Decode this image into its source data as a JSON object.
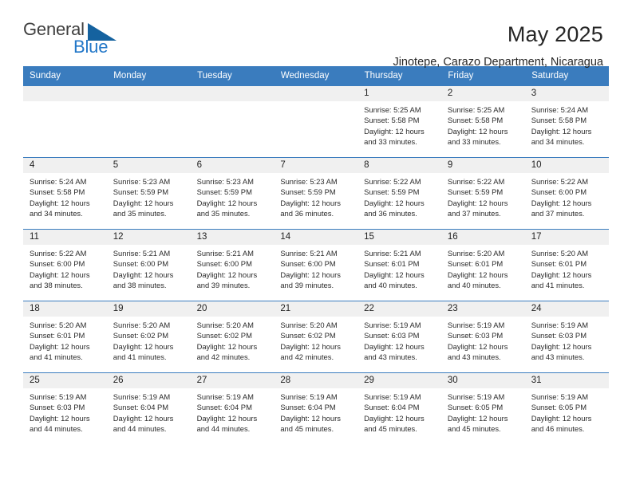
{
  "brand": {
    "name_primary": "General",
    "name_secondary": "Blue",
    "triangle_color": "#15629f",
    "blue_color": "#2277c8"
  },
  "header": {
    "title": "May 2025",
    "subtitle": "Jinotepe, Carazo Department, Nicaragua"
  },
  "theme": {
    "header_blue": "#3a7cbe",
    "daynum_band": "#f0f0f0",
    "text": "#2b2b2b"
  },
  "weekday_headers": [
    "Sunday",
    "Monday",
    "Tuesday",
    "Wednesday",
    "Thursday",
    "Friday",
    "Saturday"
  ],
  "labels": {
    "sunrise_prefix": "Sunrise: ",
    "sunset_prefix": "Sunset: ",
    "daylight_prefix": "Daylight: "
  },
  "weeks": [
    [
      {
        "day": "",
        "empty": true,
        "sunrise": "",
        "sunset": "",
        "daylight_line1": "",
        "daylight_line2": ""
      },
      {
        "day": "",
        "empty": true,
        "sunrise": "",
        "sunset": "",
        "daylight_line1": "",
        "daylight_line2": ""
      },
      {
        "day": "",
        "empty": true,
        "sunrise": "",
        "sunset": "",
        "daylight_line1": "",
        "daylight_line2": ""
      },
      {
        "day": "",
        "empty": true,
        "sunrise": "",
        "sunset": "",
        "daylight_line1": "",
        "daylight_line2": ""
      },
      {
        "day": "1",
        "empty": false,
        "sunrise": "Sunrise: 5:25 AM",
        "sunset": "Sunset: 5:58 PM",
        "daylight_line1": "Daylight: 12 hours",
        "daylight_line2": "and 33 minutes."
      },
      {
        "day": "2",
        "empty": false,
        "sunrise": "Sunrise: 5:25 AM",
        "sunset": "Sunset: 5:58 PM",
        "daylight_line1": "Daylight: 12 hours",
        "daylight_line2": "and 33 minutes."
      },
      {
        "day": "3",
        "empty": false,
        "sunrise": "Sunrise: 5:24 AM",
        "sunset": "Sunset: 5:58 PM",
        "daylight_line1": "Daylight: 12 hours",
        "daylight_line2": "and 34 minutes."
      }
    ],
    [
      {
        "day": "4",
        "empty": false,
        "sunrise": "Sunrise: 5:24 AM",
        "sunset": "Sunset: 5:58 PM",
        "daylight_line1": "Daylight: 12 hours",
        "daylight_line2": "and 34 minutes."
      },
      {
        "day": "5",
        "empty": false,
        "sunrise": "Sunrise: 5:23 AM",
        "sunset": "Sunset: 5:59 PM",
        "daylight_line1": "Daylight: 12 hours",
        "daylight_line2": "and 35 minutes."
      },
      {
        "day": "6",
        "empty": false,
        "sunrise": "Sunrise: 5:23 AM",
        "sunset": "Sunset: 5:59 PM",
        "daylight_line1": "Daylight: 12 hours",
        "daylight_line2": "and 35 minutes."
      },
      {
        "day": "7",
        "empty": false,
        "sunrise": "Sunrise: 5:23 AM",
        "sunset": "Sunset: 5:59 PM",
        "daylight_line1": "Daylight: 12 hours",
        "daylight_line2": "and 36 minutes."
      },
      {
        "day": "8",
        "empty": false,
        "sunrise": "Sunrise: 5:22 AM",
        "sunset": "Sunset: 5:59 PM",
        "daylight_line1": "Daylight: 12 hours",
        "daylight_line2": "and 36 minutes."
      },
      {
        "day": "9",
        "empty": false,
        "sunrise": "Sunrise: 5:22 AM",
        "sunset": "Sunset: 5:59 PM",
        "daylight_line1": "Daylight: 12 hours",
        "daylight_line2": "and 37 minutes."
      },
      {
        "day": "10",
        "empty": false,
        "sunrise": "Sunrise: 5:22 AM",
        "sunset": "Sunset: 6:00 PM",
        "daylight_line1": "Daylight: 12 hours",
        "daylight_line2": "and 37 minutes."
      }
    ],
    [
      {
        "day": "11",
        "empty": false,
        "sunrise": "Sunrise: 5:22 AM",
        "sunset": "Sunset: 6:00 PM",
        "daylight_line1": "Daylight: 12 hours",
        "daylight_line2": "and 38 minutes."
      },
      {
        "day": "12",
        "empty": false,
        "sunrise": "Sunrise: 5:21 AM",
        "sunset": "Sunset: 6:00 PM",
        "daylight_line1": "Daylight: 12 hours",
        "daylight_line2": "and 38 minutes."
      },
      {
        "day": "13",
        "empty": false,
        "sunrise": "Sunrise: 5:21 AM",
        "sunset": "Sunset: 6:00 PM",
        "daylight_line1": "Daylight: 12 hours",
        "daylight_line2": "and 39 minutes."
      },
      {
        "day": "14",
        "empty": false,
        "sunrise": "Sunrise: 5:21 AM",
        "sunset": "Sunset: 6:00 PM",
        "daylight_line1": "Daylight: 12 hours",
        "daylight_line2": "and 39 minutes."
      },
      {
        "day": "15",
        "empty": false,
        "sunrise": "Sunrise: 5:21 AM",
        "sunset": "Sunset: 6:01 PM",
        "daylight_line1": "Daylight: 12 hours",
        "daylight_line2": "and 40 minutes."
      },
      {
        "day": "16",
        "empty": false,
        "sunrise": "Sunrise: 5:20 AM",
        "sunset": "Sunset: 6:01 PM",
        "daylight_line1": "Daylight: 12 hours",
        "daylight_line2": "and 40 minutes."
      },
      {
        "day": "17",
        "empty": false,
        "sunrise": "Sunrise: 5:20 AM",
        "sunset": "Sunset: 6:01 PM",
        "daylight_line1": "Daylight: 12 hours",
        "daylight_line2": "and 41 minutes."
      }
    ],
    [
      {
        "day": "18",
        "empty": false,
        "sunrise": "Sunrise: 5:20 AM",
        "sunset": "Sunset: 6:01 PM",
        "daylight_line1": "Daylight: 12 hours",
        "daylight_line2": "and 41 minutes."
      },
      {
        "day": "19",
        "empty": false,
        "sunrise": "Sunrise: 5:20 AM",
        "sunset": "Sunset: 6:02 PM",
        "daylight_line1": "Daylight: 12 hours",
        "daylight_line2": "and 41 minutes."
      },
      {
        "day": "20",
        "empty": false,
        "sunrise": "Sunrise: 5:20 AM",
        "sunset": "Sunset: 6:02 PM",
        "daylight_line1": "Daylight: 12 hours",
        "daylight_line2": "and 42 minutes."
      },
      {
        "day": "21",
        "empty": false,
        "sunrise": "Sunrise: 5:20 AM",
        "sunset": "Sunset: 6:02 PM",
        "daylight_line1": "Daylight: 12 hours",
        "daylight_line2": "and 42 minutes."
      },
      {
        "day": "22",
        "empty": false,
        "sunrise": "Sunrise: 5:19 AM",
        "sunset": "Sunset: 6:03 PM",
        "daylight_line1": "Daylight: 12 hours",
        "daylight_line2": "and 43 minutes."
      },
      {
        "day": "23",
        "empty": false,
        "sunrise": "Sunrise: 5:19 AM",
        "sunset": "Sunset: 6:03 PM",
        "daylight_line1": "Daylight: 12 hours",
        "daylight_line2": "and 43 minutes."
      },
      {
        "day": "24",
        "empty": false,
        "sunrise": "Sunrise: 5:19 AM",
        "sunset": "Sunset: 6:03 PM",
        "daylight_line1": "Daylight: 12 hours",
        "daylight_line2": "and 43 minutes."
      }
    ],
    [
      {
        "day": "25",
        "empty": false,
        "sunrise": "Sunrise: 5:19 AM",
        "sunset": "Sunset: 6:03 PM",
        "daylight_line1": "Daylight: 12 hours",
        "daylight_line2": "and 44 minutes."
      },
      {
        "day": "26",
        "empty": false,
        "sunrise": "Sunrise: 5:19 AM",
        "sunset": "Sunset: 6:04 PM",
        "daylight_line1": "Daylight: 12 hours",
        "daylight_line2": "and 44 minutes."
      },
      {
        "day": "27",
        "empty": false,
        "sunrise": "Sunrise: 5:19 AM",
        "sunset": "Sunset: 6:04 PM",
        "daylight_line1": "Daylight: 12 hours",
        "daylight_line2": "and 44 minutes."
      },
      {
        "day": "28",
        "empty": false,
        "sunrise": "Sunrise: 5:19 AM",
        "sunset": "Sunset: 6:04 PM",
        "daylight_line1": "Daylight: 12 hours",
        "daylight_line2": "and 45 minutes."
      },
      {
        "day": "29",
        "empty": false,
        "sunrise": "Sunrise: 5:19 AM",
        "sunset": "Sunset: 6:04 PM",
        "daylight_line1": "Daylight: 12 hours",
        "daylight_line2": "and 45 minutes."
      },
      {
        "day": "30",
        "empty": false,
        "sunrise": "Sunrise: 5:19 AM",
        "sunset": "Sunset: 6:05 PM",
        "daylight_line1": "Daylight: 12 hours",
        "daylight_line2": "and 45 minutes."
      },
      {
        "day": "31",
        "empty": false,
        "sunrise": "Sunrise: 5:19 AM",
        "sunset": "Sunset: 6:05 PM",
        "daylight_line1": "Daylight: 12 hours",
        "daylight_line2": "and 46 minutes."
      }
    ]
  ]
}
